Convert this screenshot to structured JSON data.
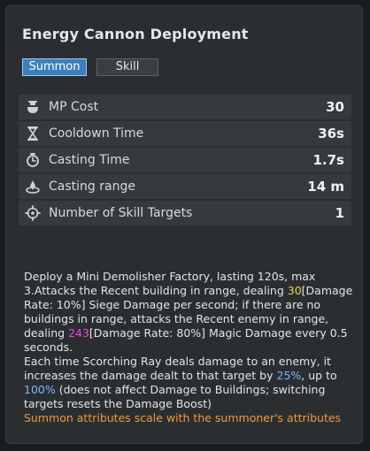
{
  "title": "Energy Cannon Deployment",
  "tabs": {
    "summon": "Summon",
    "skill": "Skill"
  },
  "stats": [
    {
      "icon": "potion-icon",
      "label": "MP Cost",
      "value": "30"
    },
    {
      "icon": "hourglass-icon",
      "label": "Cooldown Time",
      "value": "36s"
    },
    {
      "icon": "stopwatch-icon",
      "label": "Casting Time",
      "value": "1.7s"
    },
    {
      "icon": "range-icon",
      "label": "Casting range",
      "value": "14 m"
    },
    {
      "icon": "crosshair-icon",
      "label": "Number of Skill Targets",
      "value": "1"
    }
  ],
  "description": {
    "p1_a": "Deploy a Mini Demolisher Factory, lasting 120s, max 3.Attacks the Recent building in range, dealing ",
    "p1_val1": "30",
    "p1_b": "[Damage Rate: 10%] Siege Damage per second; if there are no buildings in range, attacks the Recent enemy in range, dealing ",
    "p1_val2": "243",
    "p1_c": "[Damage Rate: 80%] Magic Damage every 0.5 seconds.",
    "p2_a": "Each time Scorching Ray deals damage to an enemy, it increases the damage dealt to that target by ",
    "p2_val1": "25%",
    "p2_b": ", up to ",
    "p2_val2": "100%",
    "p2_c": " (does not affect Damage to Buildings; switching targets resets the Damage Boost)",
    "p3": "Summon attributes scale with the summoner's attributes"
  },
  "colors": {
    "highlight_yellow": "#f0d440",
    "highlight_magenta": "#ee44ee",
    "highlight_blue": "#7fb5ff",
    "note_orange": "#f09a3e",
    "tab_active": "#3c7fbd"
  }
}
